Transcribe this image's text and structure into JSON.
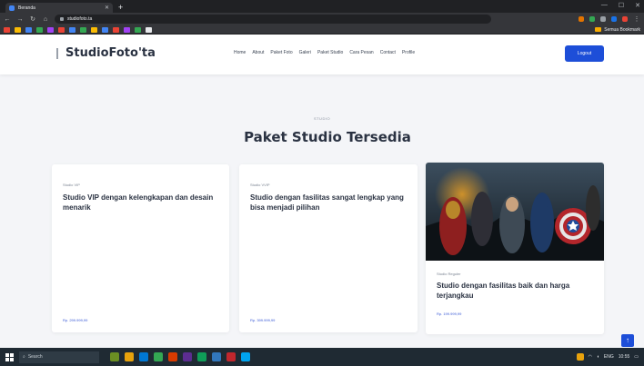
{
  "browser": {
    "tab_title": "Beranda",
    "url": "studiofoto.ta",
    "bookmarks_folder": "Semua Bookmark"
  },
  "site": {
    "brand": "StudioFoto'ta",
    "nav": [
      "Home",
      "About",
      "Paket Foto",
      "Galeri",
      "Paket Studio",
      "Cara Pesan",
      "Contact",
      "Profile"
    ],
    "login_label": "Logout",
    "eyebrow": "STUDIO",
    "heading": "Paket Studio Tersedia",
    "cards": [
      {
        "label": "Studio VIP",
        "title": "Studio VIP dengan kelengkapan dan desain menarik",
        "price": "Rp. 299.999,99"
      },
      {
        "label": "Studio VVIP",
        "title": "Studio dengan fasilitas sangat lengkap yang bisa menjadi pilihan",
        "price": "Rp. 399.999,99"
      },
      {
        "label": "Studio Reguler",
        "title": "Studio dengan fasilitas baik dan harga terjangkau",
        "price": "Rp. 199.999,99"
      }
    ]
  },
  "taskbar": {
    "search_placeholder": "Search",
    "time": "10:55",
    "lang": "ENG"
  },
  "colors": {
    "accent": "#1d4ed8",
    "heading": "#2a3242"
  }
}
